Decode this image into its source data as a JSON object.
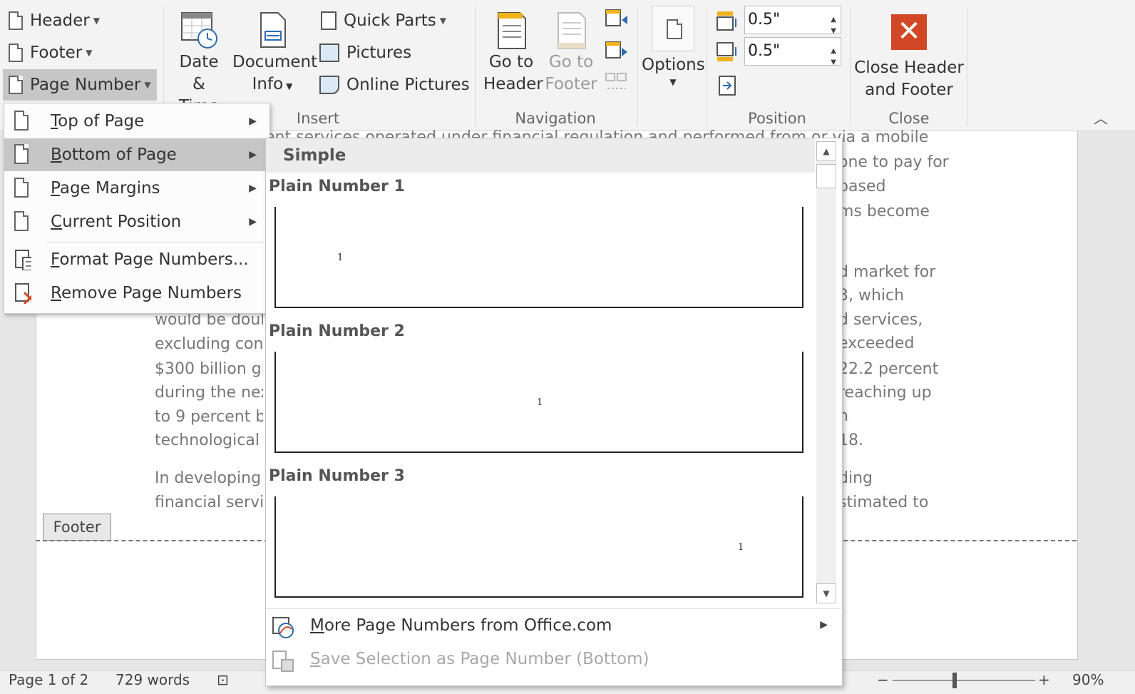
{
  "ribbon": {
    "header_footer": {
      "header": "Header",
      "footer": "Footer",
      "page_number": "Page Number"
    },
    "insert": {
      "date_time_1": "Date &",
      "date_time_2": "Time",
      "doc_info_1": "Document",
      "doc_info_2": "Info",
      "quick_parts": "Quick Parts",
      "pictures": "Pictures",
      "online_pictures": "Online Pictures",
      "label": "Insert"
    },
    "navigation": {
      "go_header_1": "Go to",
      "go_header_2": "Header",
      "go_footer_1": "Go to",
      "go_footer_2": "Footer",
      "label": "Navigation"
    },
    "options": {
      "label": "Options"
    },
    "position": {
      "header_from_top": "0.5\"",
      "footer_from_bottom": "0.5\"",
      "label": "Position"
    },
    "close": {
      "btn_1": "Close Header",
      "btn_2": "and Footer",
      "label": "Close"
    }
  },
  "page_number_menu": {
    "items": [
      {
        "label": "Top of Page",
        "mnemonic": "T",
        "rest": "op of Page"
      },
      {
        "label": "Bottom of Page",
        "mnemonic": "B",
        "rest": "ottom of Page"
      },
      {
        "label": "Page Margins",
        "mnemonic": "P",
        "rest": "age Margins"
      },
      {
        "label": "Current Position",
        "mnemonic": "C",
        "rest": "urrent Position"
      },
      {
        "label": "Format Page Numbers...",
        "mnemonic": "F",
        "rest": "ormat Page Numbers..."
      },
      {
        "label": "Remove Page Numbers",
        "mnemonic": "R",
        "rest": "emove Page Numbers"
      }
    ]
  },
  "gallery": {
    "section": "Simple",
    "entries": [
      {
        "title": "Plain Number 1",
        "number": "1"
      },
      {
        "title": "Plain Number 2",
        "number": "1"
      },
      {
        "title": "Plain Number 3",
        "number": "1"
      }
    ],
    "more": {
      "mnemonic": "M",
      "rest": "ore Page Numbers from Office.com"
    },
    "save": {
      "mnemonic": "S",
      "rest": "ave Selection as Page Number (Bottom)"
    }
  },
  "document": {
    "top_line": "ent services operated under financial regulation and performed from or via a mobile",
    "right_fragments": [
      "one to pay for",
      "based",
      "ms become",
      "d market for",
      "3, which",
      "d services,",
      "exceeded",
      "22.2 percent",
      "reaching up",
      "n",
      "18.",
      "ding",
      "stimated to"
    ],
    "left_fragments": [
      "would be doub",
      "excluding cont",
      "$300 billion gl",
      "during the nex",
      "to 9 percent b",
      "technological i",
      "In developing",
      "financial servi"
    ],
    "footer_tag": "Footer"
  },
  "status": {
    "page": "Page 1 of 2",
    "words": "729 words",
    "zoom": "90%"
  }
}
